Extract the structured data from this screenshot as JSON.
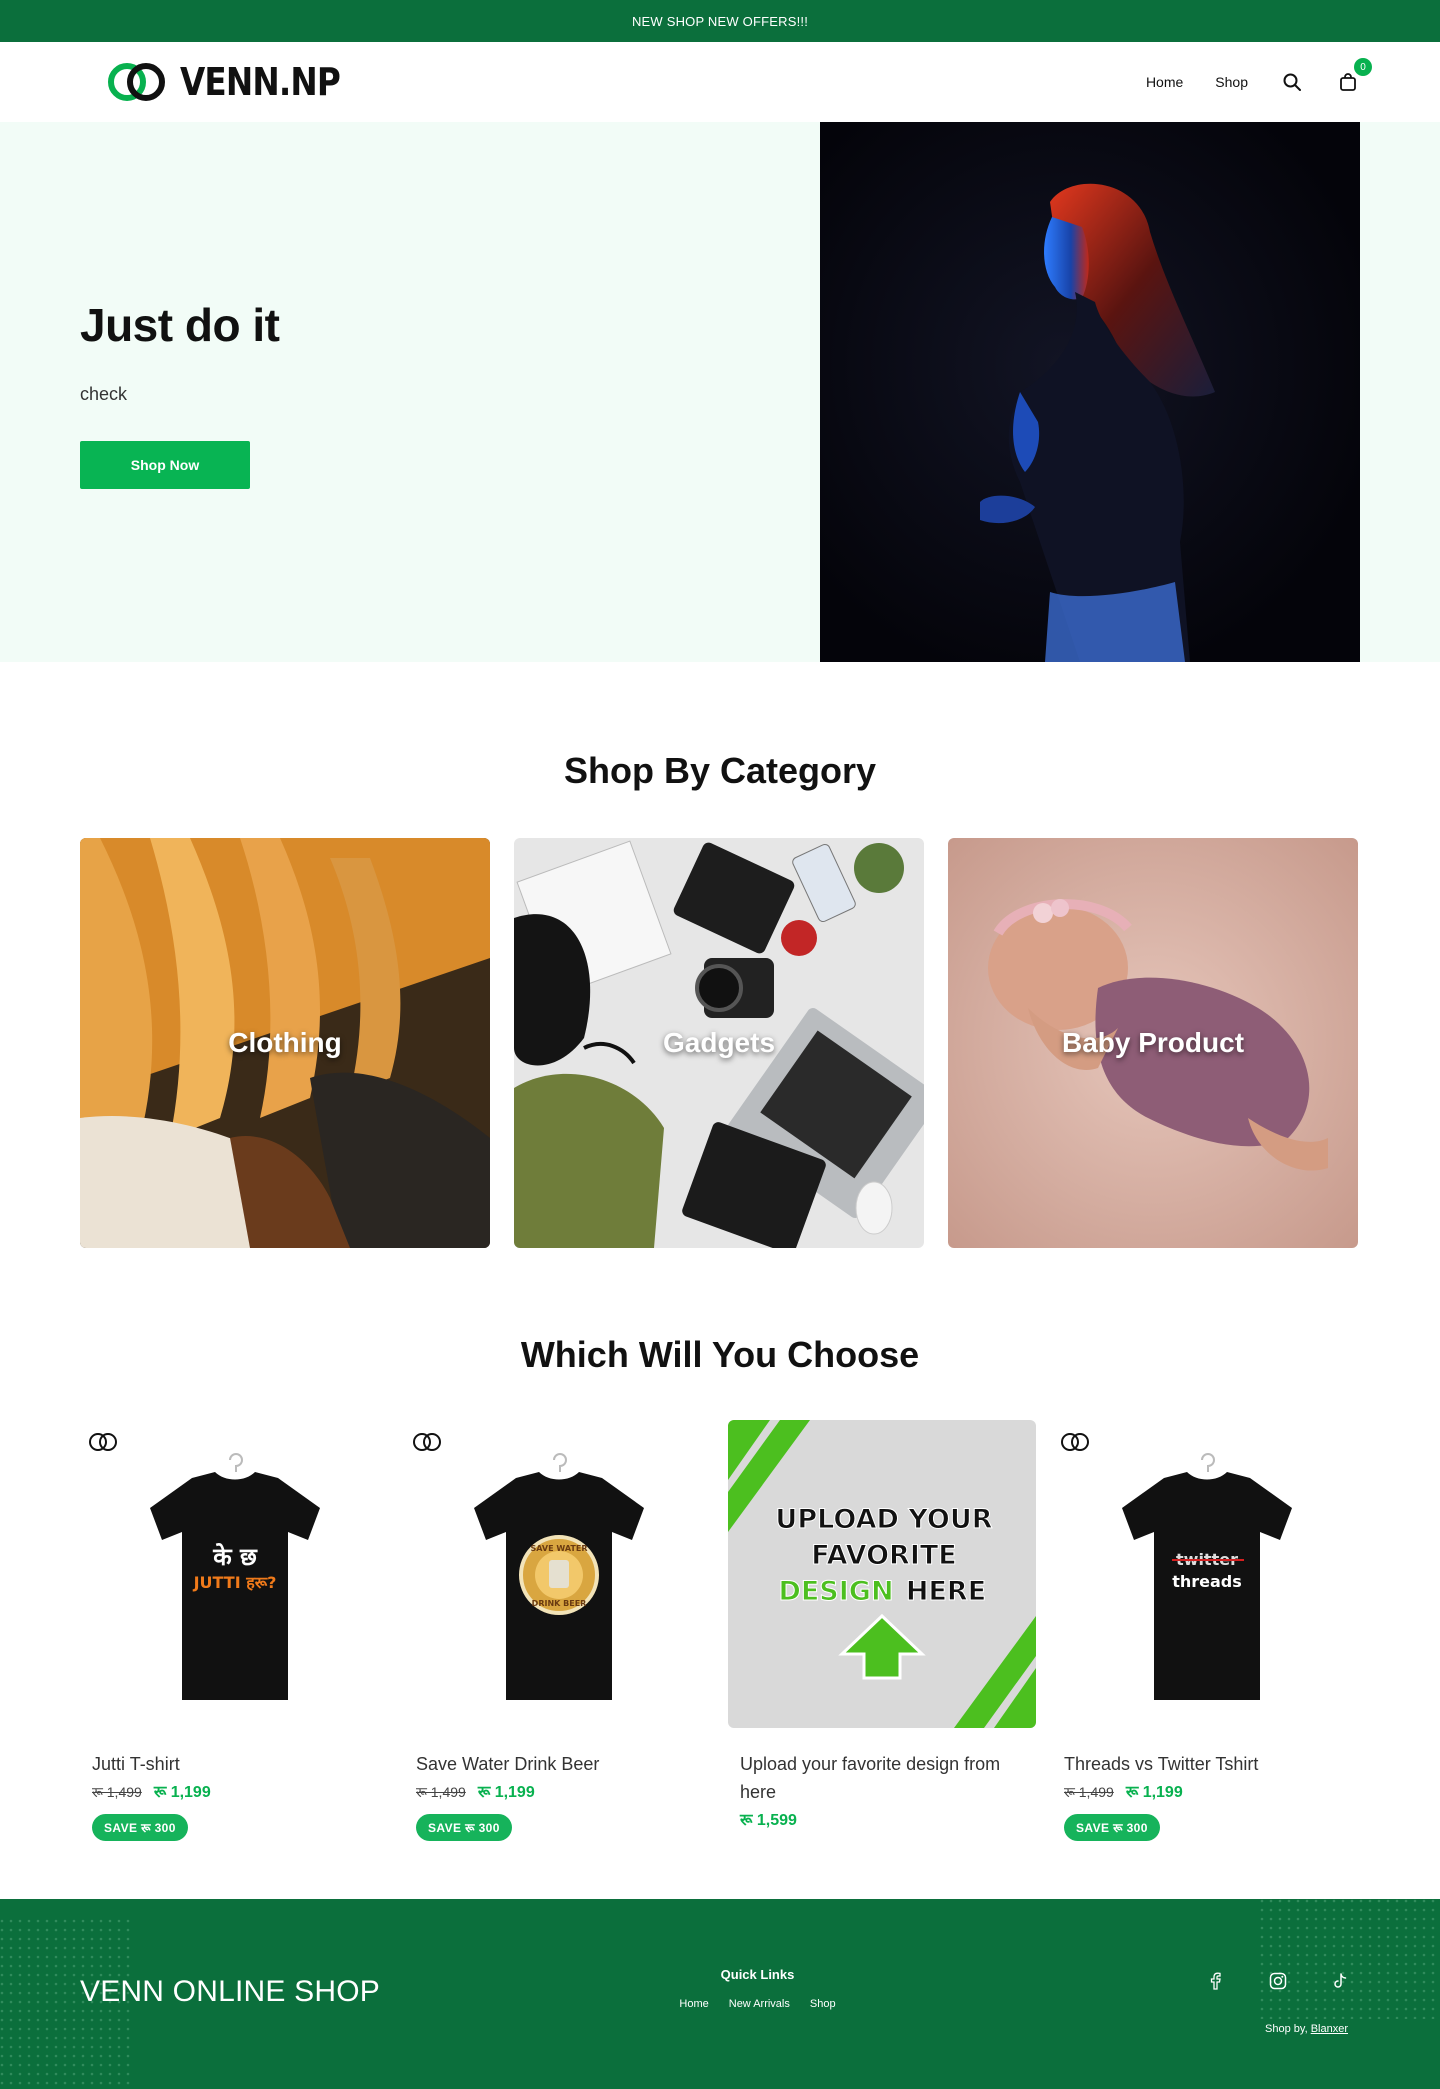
{
  "announcement": "NEW SHOP NEW OFFERS!!!",
  "brand": {
    "name": "VENN.NP",
    "colors": {
      "primary": "#0b6f3c",
      "accent": "#08b453"
    }
  },
  "nav": {
    "items": [
      "Home",
      "Shop"
    ],
    "search_icon": "search-icon",
    "cart_icon": "shopping-bag-icon",
    "cart_count": "0"
  },
  "hero": {
    "title": "Just do it",
    "subtitle": "check",
    "button": "Shop Now"
  },
  "categories": {
    "title": "Shop By Category",
    "items": [
      {
        "label": "Clothing"
      },
      {
        "label": "Gadgets"
      },
      {
        "label": "Baby Product"
      }
    ]
  },
  "products": {
    "title": "Which Will You Choose",
    "items": [
      {
        "name": "Jutti T-shirt",
        "old_price": "रू 1,499",
        "price": "रू 1,199",
        "badge": "SAVE रू 300",
        "print_line1": "के छ",
        "print_line2": "JUTTI हरू?"
      },
      {
        "name": "Save Water Drink Beer",
        "old_price": "रू 1,499",
        "price": "रू 1,199",
        "badge": "SAVE रू 300",
        "print_line1": "SAVE WATER",
        "print_line2": "DRINK BEER"
      },
      {
        "name": "Upload your favorite design from here",
        "old_price": "",
        "price": "रू 1,599",
        "badge": "",
        "print_line1": "UPLOAD YOUR",
        "print_line2": "FAVORITE",
        "print_line3": "DESIGN",
        "print_line4": "HERE"
      },
      {
        "name": "Threads vs Twitter Tshirt",
        "old_price": "रू 1,499",
        "price": "रू 1,199",
        "badge": "SAVE रू 300",
        "print_line1": "twitter",
        "print_line2": "threads"
      }
    ]
  },
  "footer": {
    "brand": "VENN ONLINE SHOP",
    "quick_links_title": "Quick Links",
    "quick_links": [
      "Home",
      "New Arrivals",
      "Shop"
    ],
    "social": [
      "facebook-icon",
      "instagram-icon",
      "tiktok-icon"
    ],
    "shop_by_label": "Shop by,",
    "shop_by_link": "Blanxer"
  }
}
